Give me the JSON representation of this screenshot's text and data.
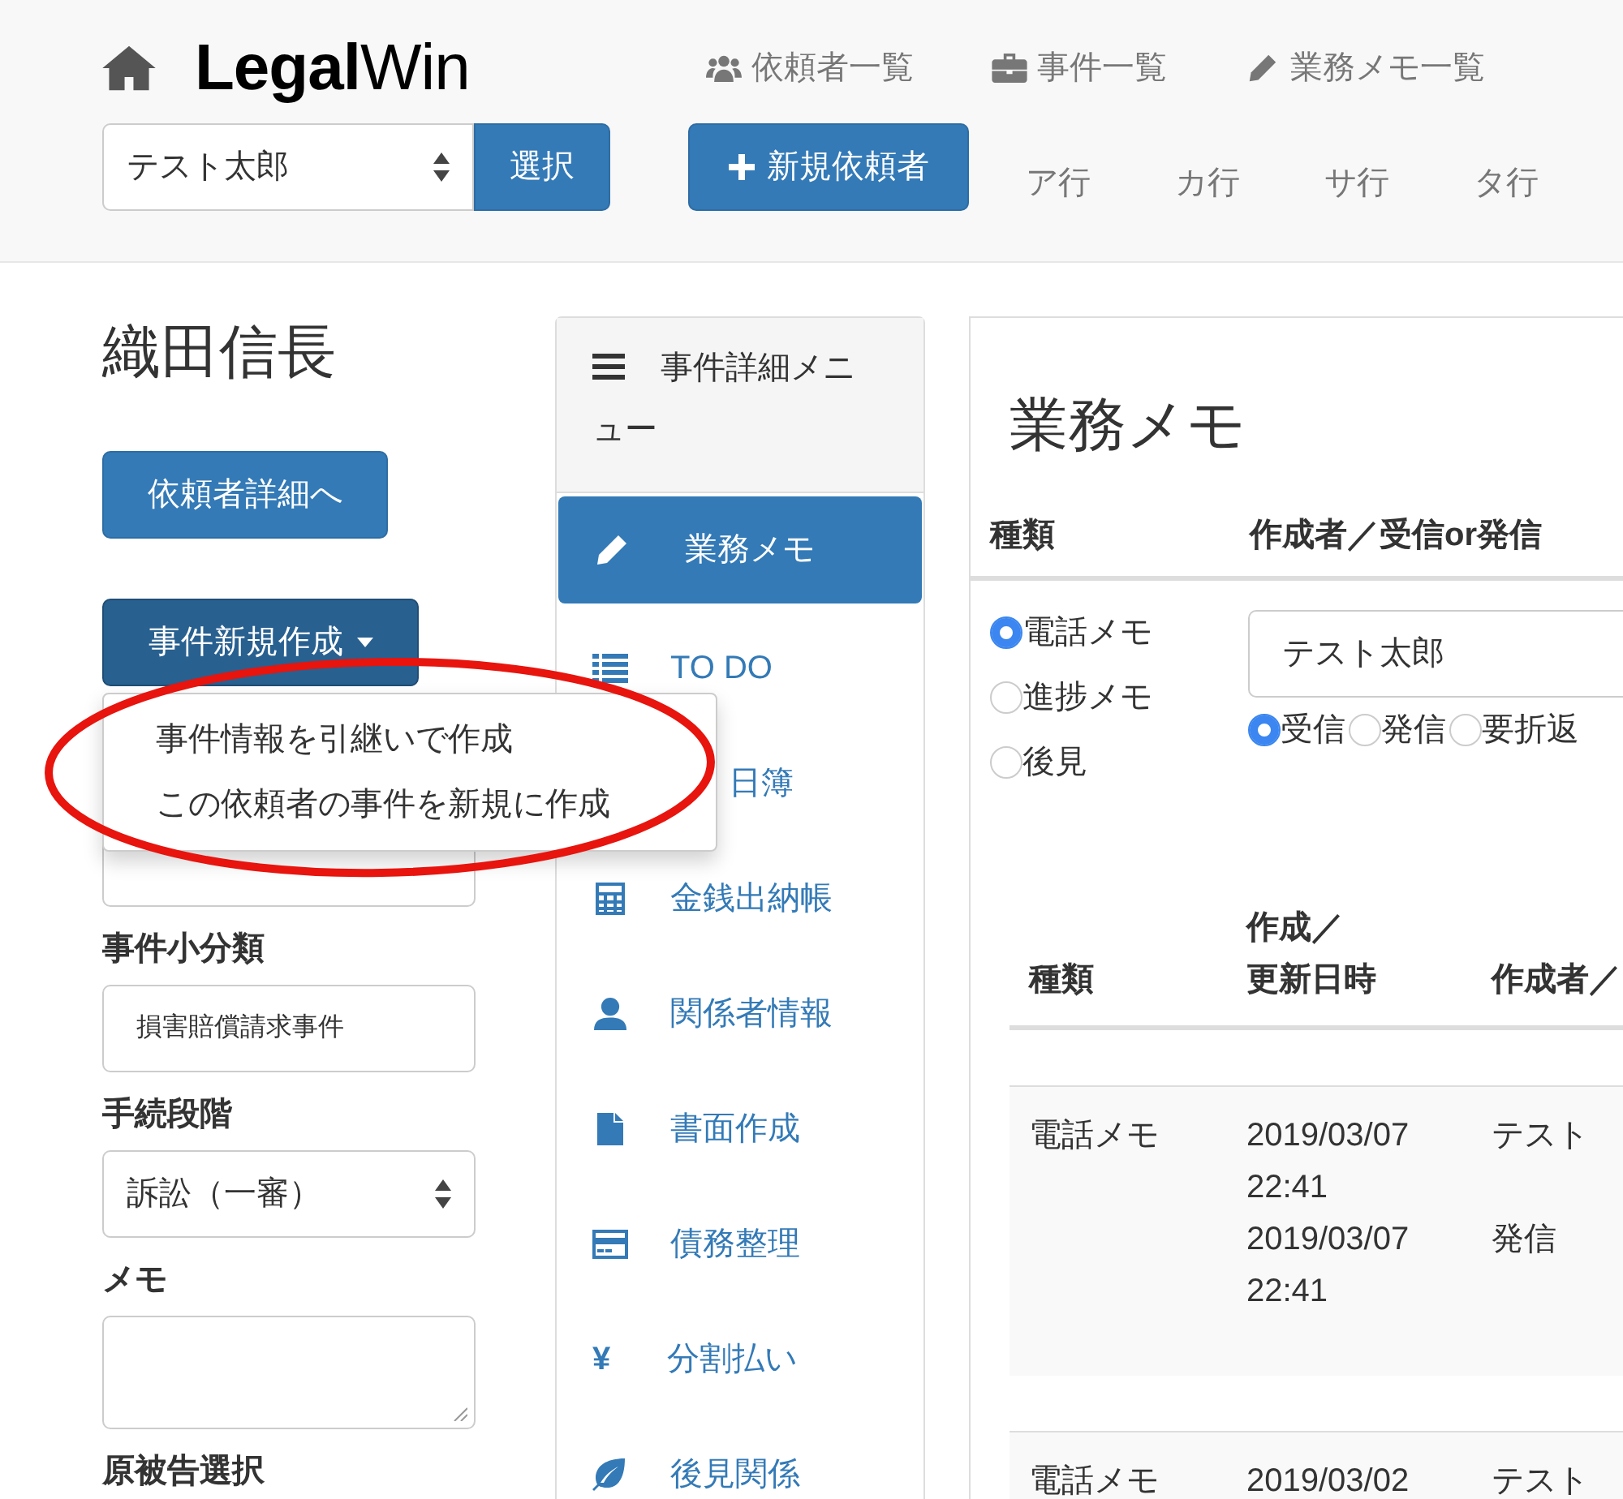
{
  "header": {
    "logo": "**Legal**Win",
    "nav_links": [
      {
        "label": "依頼者一覧"
      },
      {
        "label": "事件一覧"
      },
      {
        "label": "業務メモ一覧"
      }
    ],
    "client_select": {
      "value": "テスト太郎"
    },
    "select_button": "選択",
    "new_client_button": "新規依頼者",
    "kana_links": [
      "ア行",
      "カ行",
      "サ行",
      "タ行"
    ]
  },
  "client": {
    "name": "織田信長",
    "detail_button": "依頼者詳細へ",
    "new_case_dropdown": {
      "label": "事件新規作成",
      "expanded": true,
      "items": [
        "事件情報を引継いで作成",
        "この依頼者の事件を新規に作成"
      ]
    }
  },
  "case_form": {
    "fields": [
      {
        "label": "事件小分類",
        "kind": "input",
        "value": "損害賠償請求事件"
      },
      {
        "label": "手続段階",
        "kind": "select",
        "value": "訴訟（一審）"
      },
      {
        "label": "メモ",
        "kind": "textarea"
      }
    ],
    "party_label": "原被告選択"
  },
  "case_menu": {
    "title": "事件詳細メニュー",
    "items": [
      {
        "label": "業務メモ",
        "selected": true
      },
      {
        "label": "TO DO",
        "selected": false
      },
      {
        "label": "日簿",
        "selected": false
      },
      {
        "label": "金銭出納帳",
        "selected": false
      },
      {
        "label": "関係者情報",
        "selected": false
      },
      {
        "label": "書面作成",
        "selected": false
      },
      {
        "label": "債務整理",
        "selected": false
      },
      {
        "label": "分割払い",
        "selected": false,
        "icon_char": "¥"
      },
      {
        "label": "後見関係",
        "selected": false
      }
    ]
  },
  "memo": {
    "title": "業務メモ",
    "form_headers": [
      "種類",
      "作成者／受信or発信"
    ],
    "types": [
      {
        "label": "電話メモ",
        "selected": true
      },
      {
        "label": "進捗メモ",
        "selected": false
      },
      {
        "label": "後見",
        "selected": false
      }
    ],
    "author": {
      "value": "テスト太郎"
    },
    "direction": [
      {
        "label": "受信",
        "selected": true
      },
      {
        "label": "発信",
        "selected": false
      },
      {
        "label": "要折返",
        "selected": false
      }
    ],
    "table": {
      "columns": [
        {
          "lines": [
            "種類"
          ]
        },
        {
          "lines": [
            "作成／",
            "更新日時"
          ]
        },
        {
          "lines": [
            "作成者／"
          ]
        }
      ],
      "rows": [
        {
          "type": "電話メモ",
          "dates": [
            "2019/03/07",
            "22:41",
            "2019/03/07",
            "22:41"
          ],
          "author": "テスト",
          "direction": "発信"
        },
        {
          "type": "電話メモ",
          "dates": [
            "2019/03/02"
          ],
          "author": "テスト"
        }
      ]
    }
  }
}
